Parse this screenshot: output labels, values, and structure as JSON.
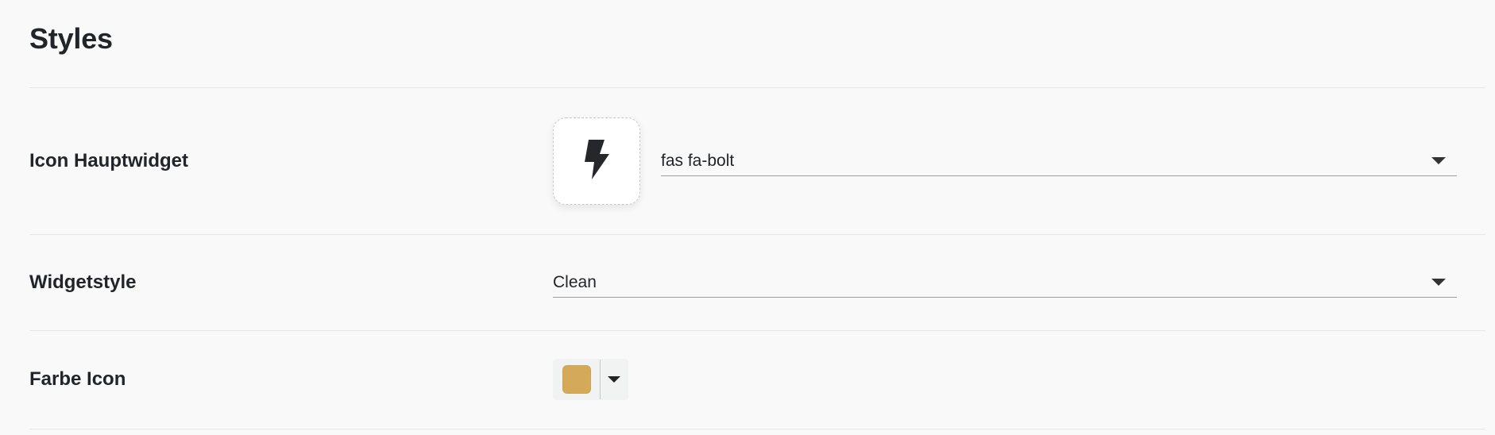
{
  "section": {
    "title": "Styles"
  },
  "rows": {
    "icon": {
      "label": "Icon Hauptwidget",
      "value": "fas fa-bolt",
      "icon_name": "bolt-icon"
    },
    "widgetstyle": {
      "label": "Widgetstyle",
      "value": "Clean"
    },
    "color": {
      "label": "Farbe Icon",
      "swatch_color": "#d4aa5a"
    }
  }
}
